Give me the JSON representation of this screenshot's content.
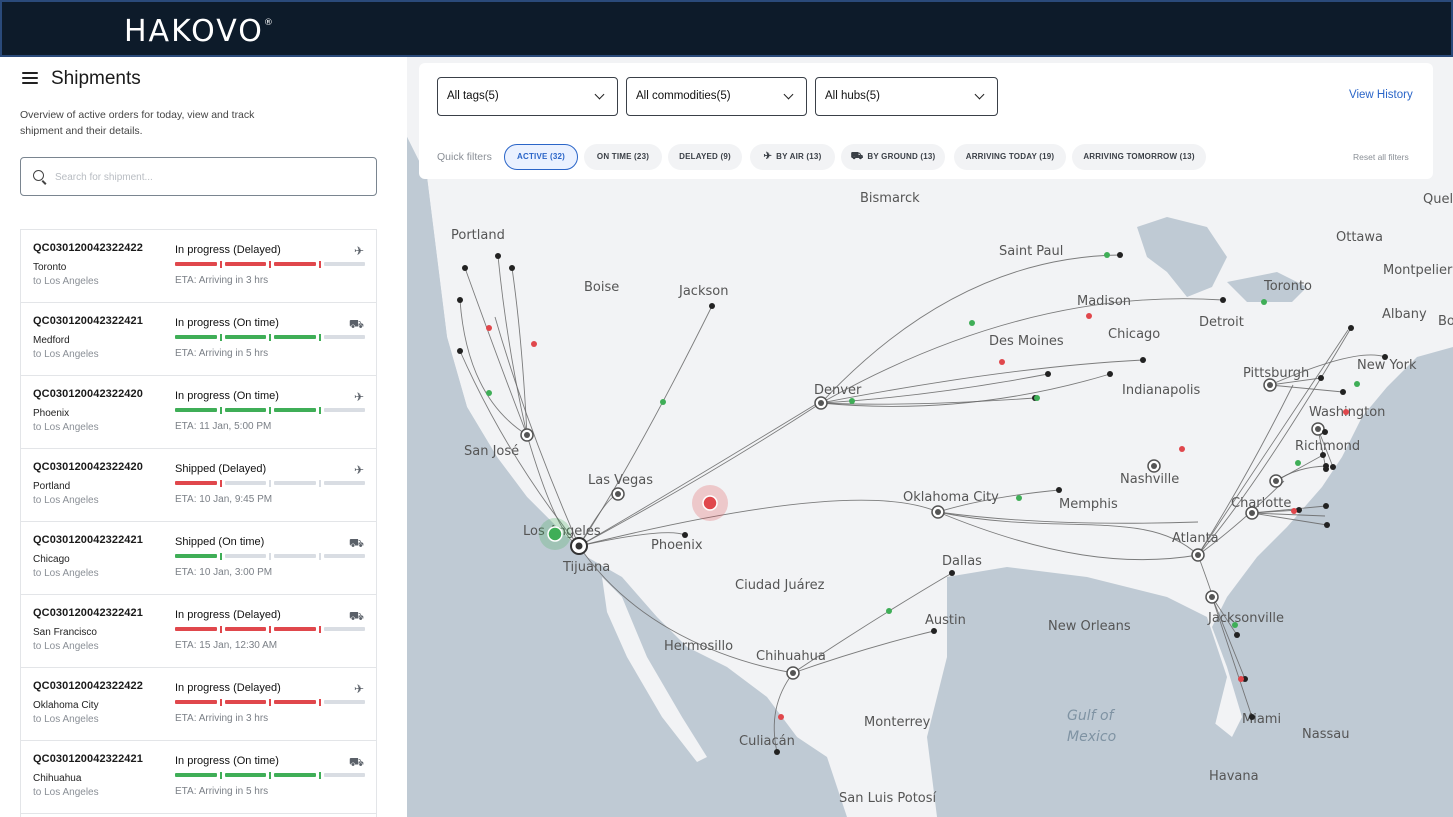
{
  "app": {
    "logo": "HAKOVO",
    "logo_mark": "®"
  },
  "sidebar": {
    "title": "Shipments",
    "subtitle": "Overview of active orders for today, view and track shipment and their details.",
    "search_placeholder": "Search for shipment...",
    "shipments": [
      {
        "code": "QC030120042322422",
        "origin": "Toronto",
        "dest": "to Los Angeles",
        "status": "In progress (Delayed)",
        "progress": "delayed",
        "eta": "ETA: Arriving in 3 hrs",
        "mode": "air"
      },
      {
        "code": "QC030120042322421",
        "origin": "Medford",
        "dest": "to Los Angeles",
        "status": "In progress (On time)",
        "progress": "ontime",
        "eta": "ETA: Arriving in 5 hrs",
        "mode": "ground"
      },
      {
        "code": "QC030120042322420",
        "origin": "Phoenix",
        "dest": "to Los Angeles",
        "status": "In progress (On time)",
        "progress": "ontime",
        "eta": "ETA: 11 Jan, 5:00 PM",
        "mode": "air"
      },
      {
        "code": "QC030120042322420",
        "origin": "Portland",
        "dest": "to Los Angeles",
        "status": "Shipped (Delayed)",
        "progress": "shipped_delayed",
        "eta": "ETA: 10 Jan, 9:45 PM",
        "mode": "air"
      },
      {
        "code": "QC030120042322421",
        "origin": "Chicago",
        "dest": "to Los Angeles",
        "status": "Shipped (On time)",
        "progress": "shipped_ontime",
        "eta": "ETA: 10 Jan, 3:00 PM",
        "mode": "ground"
      },
      {
        "code": "QC030120042322421",
        "origin": "San Francisco",
        "dest": "to Los Angeles",
        "status": "In progress (Delayed)",
        "progress": "delayed",
        "eta": "ETA: 15 Jan, 12:30 AM",
        "mode": "ground"
      },
      {
        "code": "QC030120042322422",
        "origin": "Oklahoma City",
        "dest": "to Los Angeles",
        "status": "In progress (Delayed)",
        "progress": "delayed",
        "eta": "ETA: Arriving in 3 hrs",
        "mode": "air"
      },
      {
        "code": "QC030120042322421",
        "origin": "Chihuahua",
        "dest": "to Los Angeles",
        "status": "In progress (On time)",
        "progress": "ontime",
        "eta": "ETA: Arriving in 5 hrs",
        "mode": "ground"
      }
    ]
  },
  "filters": {
    "tags": "All tags(5)",
    "commodities": "All commodities(5)",
    "hubs": "All hubs(5)",
    "view_history": "View History",
    "quick_label": "Quick filters",
    "chips": [
      "ACTIVE (32)",
      "ON TIME (23)",
      "DELAYED (9)",
      "BY AIR (13)",
      "BY GROUND (13)",
      "ARRIVING TODAY (19)",
      "ARRIVING TOMORROW (13)"
    ],
    "reset": "Reset all filters"
  },
  "map": {
    "labels": [
      "Bismarck",
      "Portland",
      "Boise",
      "Jackson",
      "Saint Paul",
      "Ottawa",
      "Madison",
      "Toronto",
      "Montpelier",
      "Detroit",
      "Chicago",
      "Albany",
      "Bos",
      "Des Moines",
      "Denver",
      "Indianapolis",
      "Pittsburgh",
      "New York",
      "Washington",
      "Richmond",
      "San José",
      "Las Vegas",
      "Oklahoma City",
      "Memphis",
      "Nashville",
      "Charlotte",
      "Los Angeles",
      "Phoenix",
      "Tijuana",
      "Atlanta",
      "Ciudad Juárez",
      "Dallas",
      "Hermosillo",
      "Austin",
      "New Orleans",
      "Jacksonville",
      "Chihuahua",
      "Monterrey",
      "Gulf of",
      "Mexico",
      "Miami",
      "Nassau",
      "Culiacán",
      "Havana",
      "San Luis Potosí",
      "Quel"
    ],
    "colors": {
      "ontime": "#3fae57",
      "delayed": "#e0474c",
      "hub": "#222222",
      "land": "#f2f3f5",
      "water": "#bfcad4"
    }
  }
}
